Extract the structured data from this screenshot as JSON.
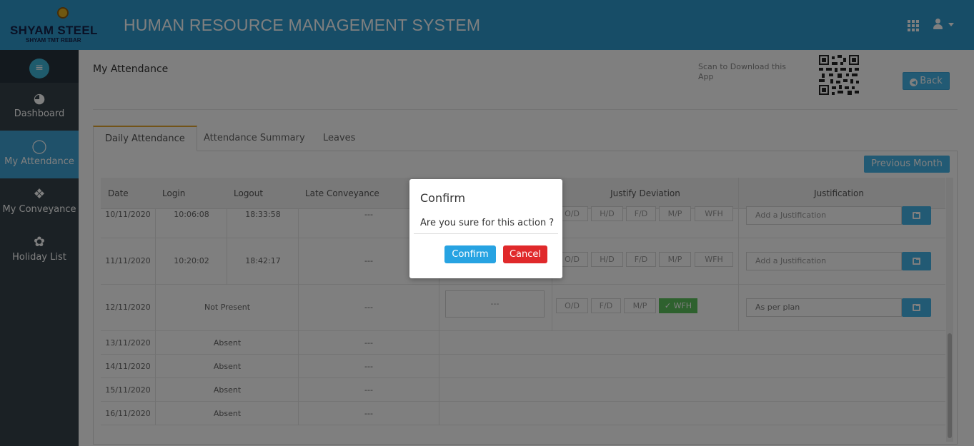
{
  "header": {
    "brand": "SHYAM STEEL",
    "brand_tagline": "SHYAM TMT REBAR",
    "app_title": "HUMAN RESOURCE MANAGEMENT SYSTEM",
    "icons": [
      "apps-grid-icon",
      "user-icon",
      "caret-down-icon"
    ]
  },
  "sidebar": {
    "items": [
      {
        "label": "Dashboard",
        "icon": "dashboard-icon"
      },
      {
        "label": "My Attendance",
        "icon": "user-outline-icon",
        "active": true
      },
      {
        "label": "My Conveyance",
        "icon": "conveyance-icon"
      },
      {
        "label": "Holiday List",
        "icon": "leaf-icon"
      }
    ]
  },
  "page": {
    "title": "My Attendance",
    "scan_text": "Scan to Download this App",
    "back_label": "Back"
  },
  "tabs": [
    {
      "label": "Daily Attendance",
      "active": true
    },
    {
      "label": "Attendance Summary"
    },
    {
      "label": "Leaves"
    }
  ],
  "prev_month_label": "Previous Month",
  "table": {
    "columns": [
      "Date",
      "Login",
      "Logout",
      "Late Conveyance",
      "Justify Deviation",
      "Justification"
    ],
    "rows": [
      {
        "date": "10/11/2020",
        "login": "10:06:08",
        "logout": "18:33:58",
        "late": "---",
        "deviations": [
          "O/D",
          "H/D",
          "F/D",
          "M/P",
          "WFH"
        ],
        "justification_placeholder": "Add a Justification"
      },
      {
        "date": "11/11/2020",
        "login": "10:20:02",
        "logout": "18:42:17",
        "late": "---",
        "deviations": [
          "O/D",
          "H/D",
          "F/D",
          "M/P",
          "WFH"
        ],
        "justification_placeholder": "Add a Justification"
      },
      {
        "date": "12/11/2020",
        "status": "Not Present",
        "late": "---",
        "extra": "---",
        "deviations": [
          "O/D",
          "F/D",
          "M/P",
          "✓ WFH"
        ],
        "justification_value": "As per plan"
      },
      {
        "date": "13/11/2020",
        "status": "Absent",
        "late": "---"
      },
      {
        "date": "14/11/2020",
        "status": "Absent",
        "late": "---"
      },
      {
        "date": "15/11/2020",
        "status": "Absent",
        "late": "---"
      },
      {
        "date": "16/11/2020",
        "status": "Absent",
        "late": "---"
      }
    ]
  },
  "modal": {
    "title": "Confirm",
    "message": "Are you sure for this action ?",
    "confirm_label": "Confirm",
    "cancel_label": "Cancel"
  },
  "colors": {
    "header": "#2f9bcf",
    "sidebar": "#36424a",
    "accent": "#45b5e8",
    "confirm": "#27a3e2",
    "cancel": "#e0292b",
    "wfh_active": "#5cc35c",
    "active_tab_border": "#e5a730"
  }
}
